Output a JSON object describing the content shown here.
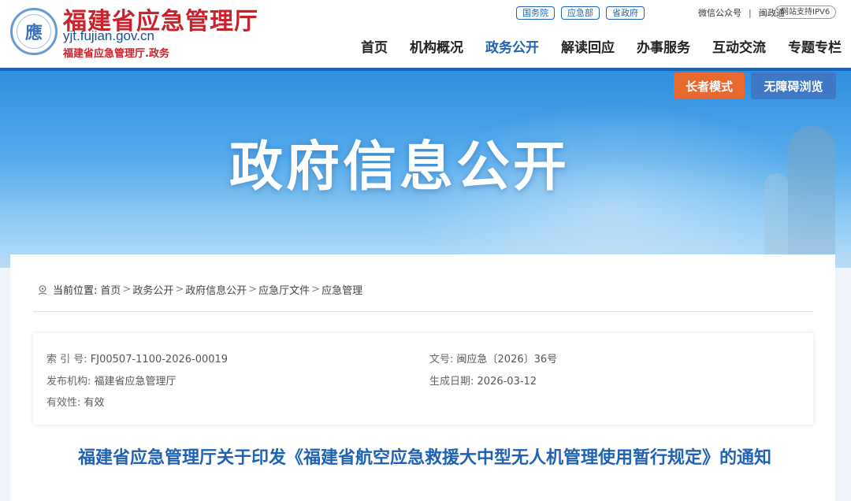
{
  "header": {
    "site_title": "福建省应急管理厅",
    "domain": "yjt.fujian.gov.cn",
    "subtitle": "福建省应急管理厅.政务",
    "emblem_char": "應",
    "top_links": [
      "国务院",
      "应急部",
      "省政府"
    ],
    "wechat": "微信公众号",
    "separator": "|",
    "minzhengtong": "闽政通",
    "ipv6": "网站支持IPV6",
    "nav": [
      "首页",
      "机构概况",
      "政务公开",
      "解读回应",
      "办事服务",
      "互动交流",
      "专题专栏"
    ],
    "nav_active_index": 2
  },
  "banner": {
    "title": "政府信息公开",
    "elder_mode": "长者模式",
    "accessible": "无障碍浏览"
  },
  "breadcrumb": {
    "label": "当前位置:",
    "items": [
      "首页",
      "政务公开",
      "政府信息公开",
      "应急厅文件",
      "应急管理"
    ],
    "sep": ">"
  },
  "meta": {
    "index_label": "索 引 号:",
    "index_value": "FJ00507-1100-2026-00019",
    "doc_no_label": "文号:",
    "doc_no_value": "闽应急〔2026〕36号",
    "publisher_label": "发布机构:",
    "publisher_value": "福建省应急管理厅",
    "date_label": "生成日期:",
    "date_value": "2026-03-12",
    "validity_label": "有效性:",
    "validity_value": "有效"
  },
  "document": {
    "title": "福建省应急管理厅关于印发《福建省航空应急救援大中型无人机管理使用暂行规定》的通知"
  },
  "colors": {
    "brand_blue": "#1f62b4",
    "brand_red": "#c8232c",
    "elder_orange": "#e8692f",
    "access_blue": "#3e77c4"
  }
}
